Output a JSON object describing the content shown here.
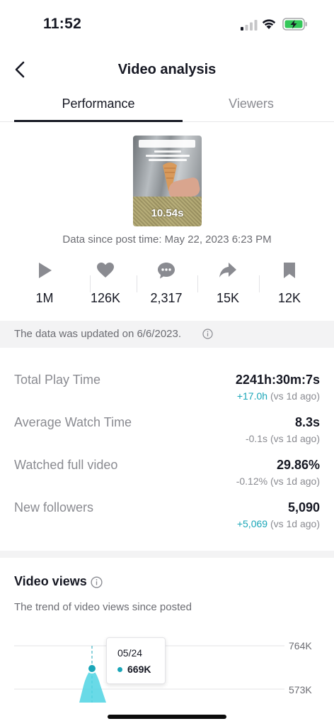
{
  "status_bar": {
    "time": "11:52",
    "icons": [
      "cellular-signal-icon",
      "wifi-icon",
      "battery-charging-icon"
    ]
  },
  "header": {
    "title": "Video analysis",
    "back_icon": "chevron-left-icon"
  },
  "tabs": [
    {
      "label": "Performance",
      "active": true
    },
    {
      "label": "Viewers",
      "active": false
    }
  ],
  "video": {
    "duration": "10.54s",
    "since_text": "Data since post time: May 22, 2023 6:23 PM"
  },
  "stats": [
    {
      "icon": "play-icon",
      "value": "1M"
    },
    {
      "icon": "heart-icon",
      "value": "126K"
    },
    {
      "icon": "comment-icon",
      "value": "2,317"
    },
    {
      "icon": "share-icon",
      "value": "15K"
    },
    {
      "icon": "bookmark-icon",
      "value": "12K"
    }
  ],
  "updated_text": "The data was updated on 6/6/2023.",
  "metrics": [
    {
      "label": "Total Play Time",
      "value": "2241h:30m:7s",
      "delta": "+17.0h",
      "delta_suffix": " (vs 1d ago)",
      "delta_positive": true
    },
    {
      "label": "Average Watch Time",
      "value": "8.3s",
      "delta": "-0.1s",
      "delta_suffix": " (vs 1d ago)",
      "delta_positive": false
    },
    {
      "label": "Watched full video",
      "value": "29.86%",
      "delta": "-0.12%",
      "delta_suffix": " (vs 1d ago)",
      "delta_positive": false
    },
    {
      "label": "New followers",
      "value": "5,090",
      "delta": "+5,069",
      "delta_suffix": " (vs 1d ago)",
      "delta_positive": true
    }
  ],
  "video_views": {
    "title": "Video views",
    "subtitle": "The trend of video views since posted",
    "tooltip": {
      "date": "05/24",
      "value": "669K"
    }
  },
  "colors": {
    "accent": "#1aa6b8",
    "text": "#161823",
    "muted": "#8a8b91"
  },
  "chart_data": {
    "type": "area",
    "y_ticks": [
      "764K",
      "573K"
    ],
    "highlighted_point": {
      "x": "05/24",
      "y": 669000,
      "label": "669K"
    },
    "ylim": [
      573000,
      764000
    ]
  }
}
